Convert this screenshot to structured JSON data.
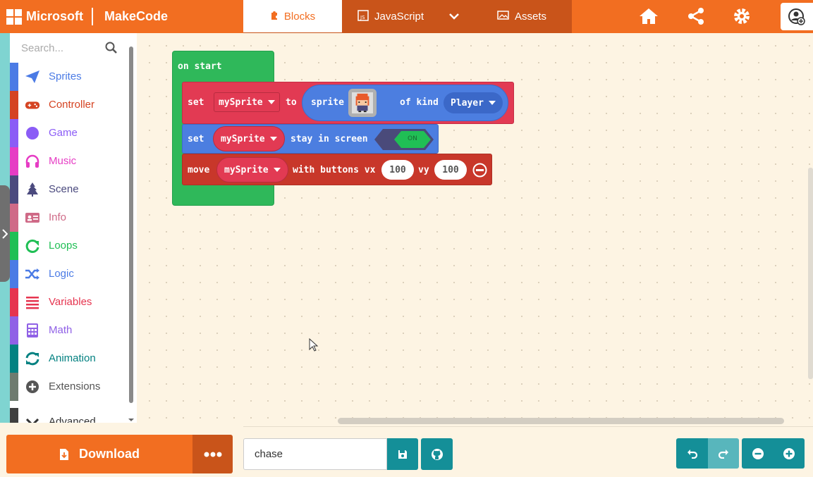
{
  "header": {
    "ms_label": "Microsoft",
    "brand": "MakeCode",
    "tabs": [
      {
        "label": "Blocks",
        "active": true
      },
      {
        "label": "JavaScript",
        "active": false
      },
      {
        "label": "Assets",
        "active": false
      }
    ],
    "icons": [
      "home-icon",
      "share-icon",
      "settings-icon",
      "user-icon"
    ]
  },
  "toolbox": {
    "search_placeholder": "Search...",
    "categories": [
      {
        "label": "Sprites",
        "color": "#4b7be5",
        "icon": "paper-plane-icon"
      },
      {
        "label": "Controller",
        "color": "#d54322",
        "icon": "gamepad-icon"
      },
      {
        "label": "Game",
        "color": "#8b5cf6",
        "icon": "circle-icon"
      },
      {
        "label": "Music",
        "color": "#e63cc4",
        "icon": "headphones-icon"
      },
      {
        "label": "Scene",
        "color": "#4b4a7e",
        "icon": "tree-icon"
      },
      {
        "label": "Info",
        "color": "#cf6a87",
        "icon": "id-card-icon"
      },
      {
        "label": "Loops",
        "color": "#20bf55",
        "icon": "loop-icon"
      },
      {
        "label": "Logic",
        "color": "#4b7be5",
        "icon": "shuffle-icon"
      },
      {
        "label": "Variables",
        "color": "#e6344f",
        "icon": "list-icon"
      },
      {
        "label": "Math",
        "color": "#9061e6",
        "icon": "calculator-icon"
      },
      {
        "label": "Animation",
        "color": "#038181",
        "icon": "refresh-icon"
      },
      {
        "label": "Extensions",
        "color": "#6e7b6f",
        "icon": "plus-circle-icon"
      },
      {
        "label": "Advanced",
        "color": "#3f3f3f",
        "icon": "chevron-down-icon"
      }
    ]
  },
  "workspace": {
    "on_start": "on start",
    "set_block": {
      "kw_set": "set",
      "var": "mySprite",
      "kw_to": "to",
      "kw_sprite": "sprite",
      "kw_kind": "of kind",
      "kind": "Player"
    },
    "stay_block": {
      "kw_set": "set",
      "var": "mySprite",
      "text": "stay in screen",
      "toggle": "ON"
    },
    "move_block": {
      "kw_move": "move",
      "var": "mySprite",
      "text": "with buttons vx",
      "vx": "100",
      "kw_vy": "vy",
      "vy": "100"
    }
  },
  "bottom": {
    "download_label": "Download",
    "project_name": "chase"
  }
}
